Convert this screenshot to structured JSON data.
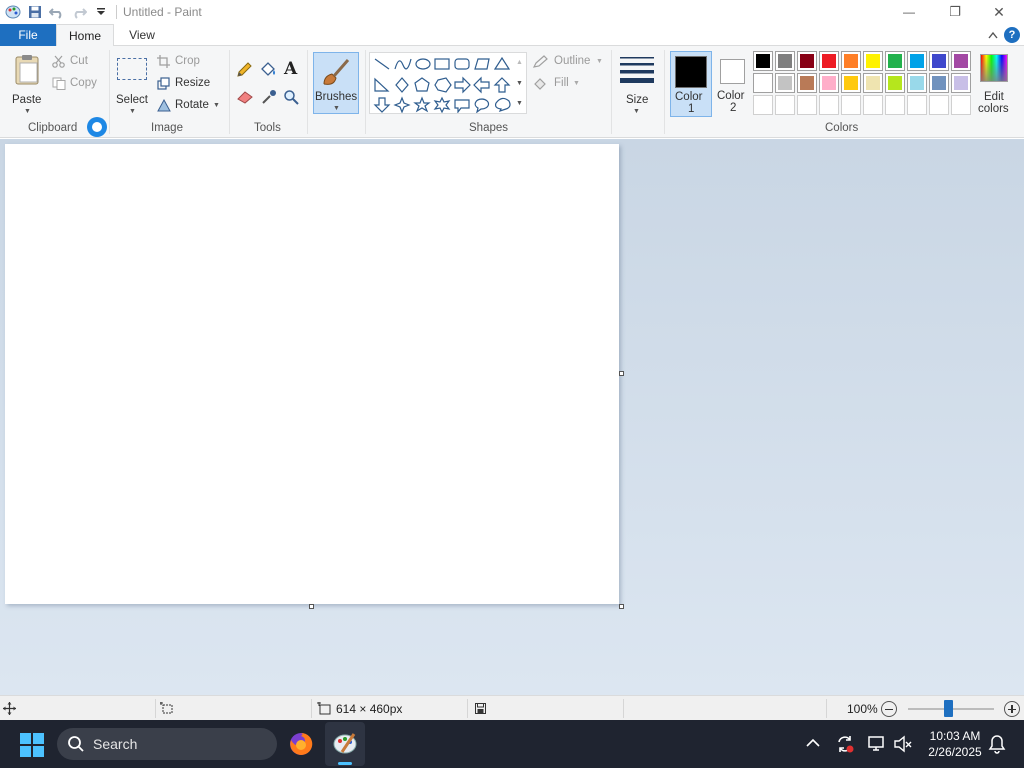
{
  "window": {
    "title": "Untitled - Paint",
    "controls": {
      "minimize": "—",
      "maximize": "❐",
      "close": "✕"
    }
  },
  "tabs": {
    "file": "File",
    "home": "Home",
    "view": "View",
    "help": "?"
  },
  "ribbon": {
    "clipboard": {
      "label": "Clipboard",
      "paste": "Paste",
      "cut": "Cut",
      "copy": "Copy"
    },
    "image": {
      "label": "Image",
      "select": "Select",
      "crop": "Crop",
      "resize": "Resize",
      "rotate": "Rotate"
    },
    "tools": {
      "label": "Tools",
      "text_glyph": "A"
    },
    "brushes": {
      "label": "Brushes"
    },
    "shapes": {
      "label": "Shapes",
      "outline": "Outline",
      "fill": "Fill"
    },
    "size": {
      "label": "Size"
    },
    "color1": {
      "label_a": "Color",
      "label_b": "1",
      "value": "#000000"
    },
    "color2": {
      "label_a": "Color",
      "label_b": "2",
      "value": "#ffffff"
    },
    "colors": {
      "label": "Colors",
      "edit_a": "Edit",
      "edit_b": "colors",
      "palette_row1": [
        "#000000",
        "#7f7f7f",
        "#880015",
        "#ed1c24",
        "#ff7f27",
        "#fff200",
        "#22b14c",
        "#00a2e8",
        "#3f48cc",
        "#a349a4"
      ],
      "palette_row2": [
        "#ffffff",
        "#c3c3c3",
        "#b97a57",
        "#ffaec9",
        "#ffc90e",
        "#efe4b0",
        "#b5e61d",
        "#99d9ea",
        "#7092be",
        "#c8bfe7"
      ]
    }
  },
  "statusbar": {
    "dimensions": "614 × 460px",
    "zoom": "100%",
    "zoom_level_percent": 100
  },
  "taskbar": {
    "search": "Search",
    "time": "10:03 AM",
    "date": "2/26/2025"
  }
}
